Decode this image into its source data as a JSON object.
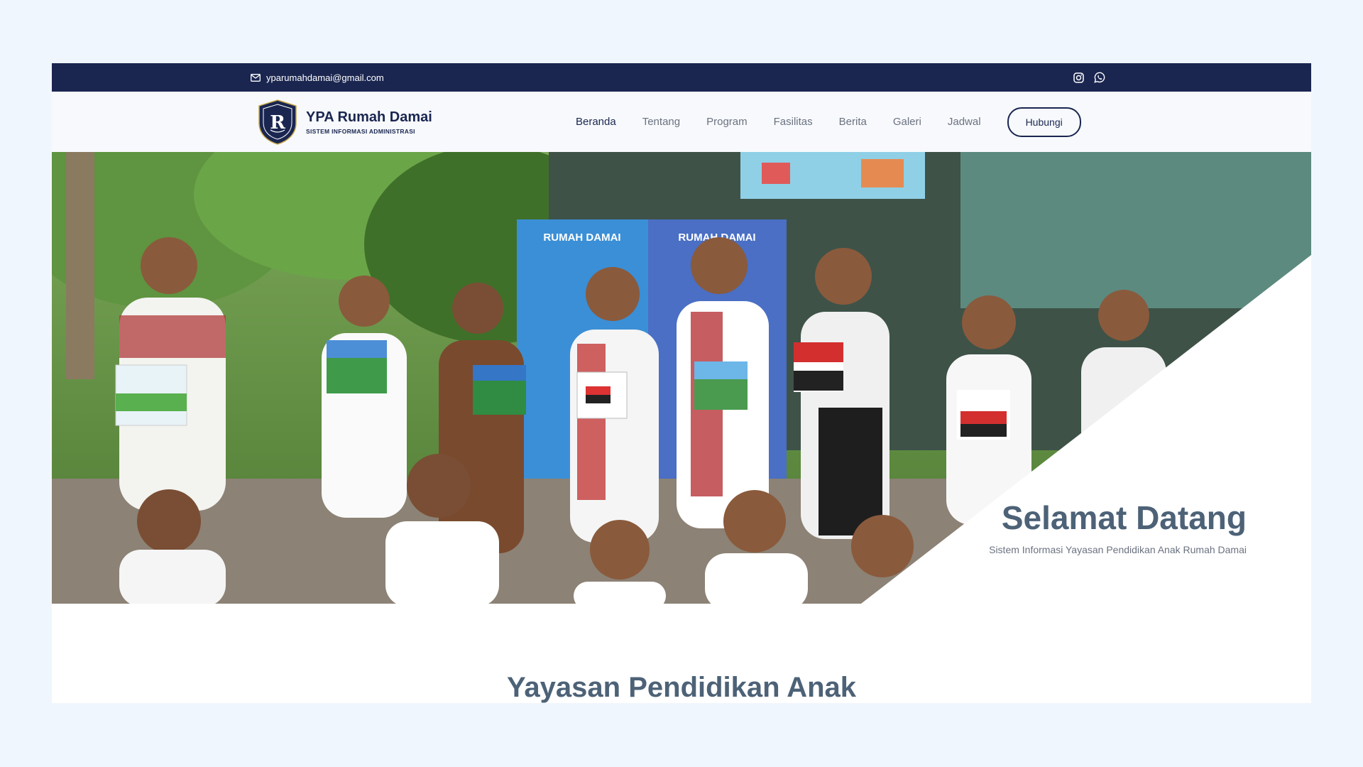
{
  "topbar": {
    "email": "yparumahdamai@gmail.com",
    "social_icons": [
      "instagram-icon",
      "whatsapp-icon"
    ]
  },
  "brand": {
    "title": "YPA Rumah Damai",
    "subtitle": "SISTEM INFORMASI ADMINISTRASI"
  },
  "nav": {
    "items": [
      {
        "label": "Beranda",
        "active": true
      },
      {
        "label": "Tentang"
      },
      {
        "label": "Program"
      },
      {
        "label": "Fasilitas"
      },
      {
        "label": "Berita"
      },
      {
        "label": "Galeri"
      },
      {
        "label": "Jadwal"
      }
    ],
    "cta_label": "Hubungi"
  },
  "hero": {
    "heading": "Selamat Datang",
    "subheading": "Sistem Informasi Yayasan Pendidikan Anak Rumah Damai",
    "banner_text_1": "RUMAH DAMAI",
    "banner_text_2": "RUMAH DAMAI"
  },
  "section": {
    "title": "Yayasan Pendidikan Anak"
  },
  "colors": {
    "navy": "#1a2650",
    "heading": "#4d6277",
    "page_bg": "#f0f6fd"
  }
}
